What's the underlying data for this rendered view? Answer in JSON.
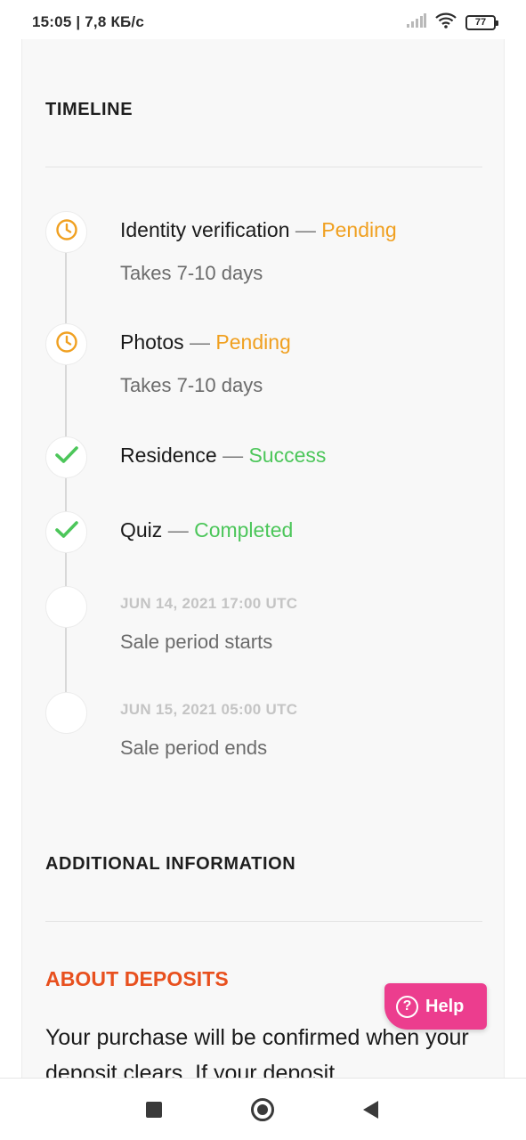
{
  "status_bar": {
    "time": "15:05 | 7,8 КБ/с",
    "battery": "77"
  },
  "timeline": {
    "heading": "TIMELINE",
    "separator": "—",
    "items": [
      {
        "label": "Identity verification",
        "status": "Pending",
        "sub": "Takes 7-10 days",
        "icon": "clock-icon"
      },
      {
        "label": "Photos",
        "status": "Pending",
        "sub": "Takes 7-10 days",
        "icon": "clock-icon"
      },
      {
        "label": "Residence",
        "status": "Success",
        "icon": "check-icon"
      },
      {
        "label": "Quiz",
        "status": "Completed",
        "icon": "check-icon"
      },
      {
        "date": "JUN 14, 2021 17:00 UTC",
        "sub": "Sale period starts"
      },
      {
        "date": "JUN 15, 2021 05:00 UTC",
        "sub": "Sale period ends"
      }
    ]
  },
  "additional": {
    "heading": "ADDITIONAL INFORMATION",
    "about_title": "ABOUT DEPOSITS",
    "about_text": "Your purchase will be confirmed when your deposit clears. If your deposit"
  },
  "help": {
    "label": "Help",
    "icon": "question-icon"
  },
  "colors": {
    "pending": "#f0a020",
    "success": "#4cc65a",
    "accent_orange": "#e8501e",
    "help_pink": "#ec3d8e"
  },
  "nav": {
    "icons": [
      "recent-apps-icon",
      "home-icon",
      "back-icon"
    ]
  }
}
